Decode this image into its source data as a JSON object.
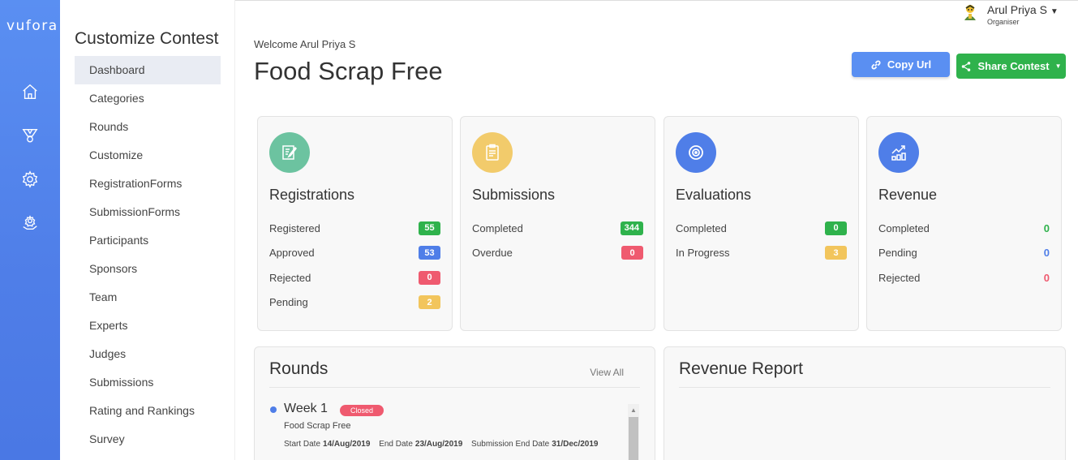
{
  "brand": {
    "logo": "vufora"
  },
  "rail": {
    "icons": [
      "home-icon",
      "trophy-icon",
      "gear-icon",
      "gear-hand-icon"
    ]
  },
  "sidebar": {
    "title": "Customize Contest",
    "items": [
      {
        "label": "Dashboard",
        "active": true
      },
      {
        "label": "Categories"
      },
      {
        "label": "Rounds"
      },
      {
        "label": "Customize"
      },
      {
        "label": "RegistrationForms"
      },
      {
        "label": "SubmissionForms"
      },
      {
        "label": "Participants"
      },
      {
        "label": "Sponsors"
      },
      {
        "label": "Team"
      },
      {
        "label": "Experts"
      },
      {
        "label": "Judges"
      },
      {
        "label": "Submissions"
      },
      {
        "label": "Rating and Rankings"
      },
      {
        "label": "Survey"
      }
    ]
  },
  "user": {
    "name": "Arul Priya S",
    "role": "Organiser"
  },
  "header": {
    "welcome": "Welcome Arul Priya S",
    "title": "Food Scrap Free",
    "copy_label": "Copy Url",
    "share_label": "Share Contest"
  },
  "stats": {
    "registrations": {
      "title": "Registrations",
      "color": "#6cc3a0",
      "rows": [
        {
          "label": "Registered",
          "value": "55",
          "status": "green"
        },
        {
          "label": "Approved",
          "value": "53",
          "status": "blue"
        },
        {
          "label": "Rejected",
          "value": "0",
          "status": "red"
        },
        {
          "label": "Pending",
          "value": "2",
          "status": "yellow"
        }
      ]
    },
    "submissions": {
      "title": "Submissions",
      "color": "#f2cb6b",
      "rows": [
        {
          "label": "Completed",
          "value": "344",
          "status": "green"
        },
        {
          "label": "Overdue",
          "value": "0",
          "status": "red"
        }
      ]
    },
    "evaluations": {
      "title": "Evaluations",
      "color": "#4f7ee8",
      "rows": [
        {
          "label": "Completed",
          "value": "0",
          "status": "green"
        },
        {
          "label": "In Progress",
          "value": "3",
          "status": "yellow"
        }
      ]
    },
    "revenue": {
      "title": "Revenue",
      "color": "#4f7ee8",
      "rows": [
        {
          "label": "Completed",
          "value": "0",
          "color": "#2fb24c"
        },
        {
          "label": "Pending",
          "value": "0",
          "color": "#4f7ee8"
        },
        {
          "label": "Rejected",
          "value": "0",
          "color": "#ef5a6f"
        }
      ]
    }
  },
  "rounds": {
    "title": "Rounds",
    "view_all": "View All",
    "items": [
      {
        "name": "Week 1",
        "status": "Closed",
        "contest": "Food Scrap Free",
        "start_label": "Start Date",
        "start": "14/Aug/2019",
        "end_label": "End Date",
        "end": "23/Aug/2019",
        "sub_end_label": "Submission End Date",
        "sub_end": "31/Dec/2019"
      }
    ]
  },
  "revenue_report": {
    "title": "Revenue Report"
  }
}
